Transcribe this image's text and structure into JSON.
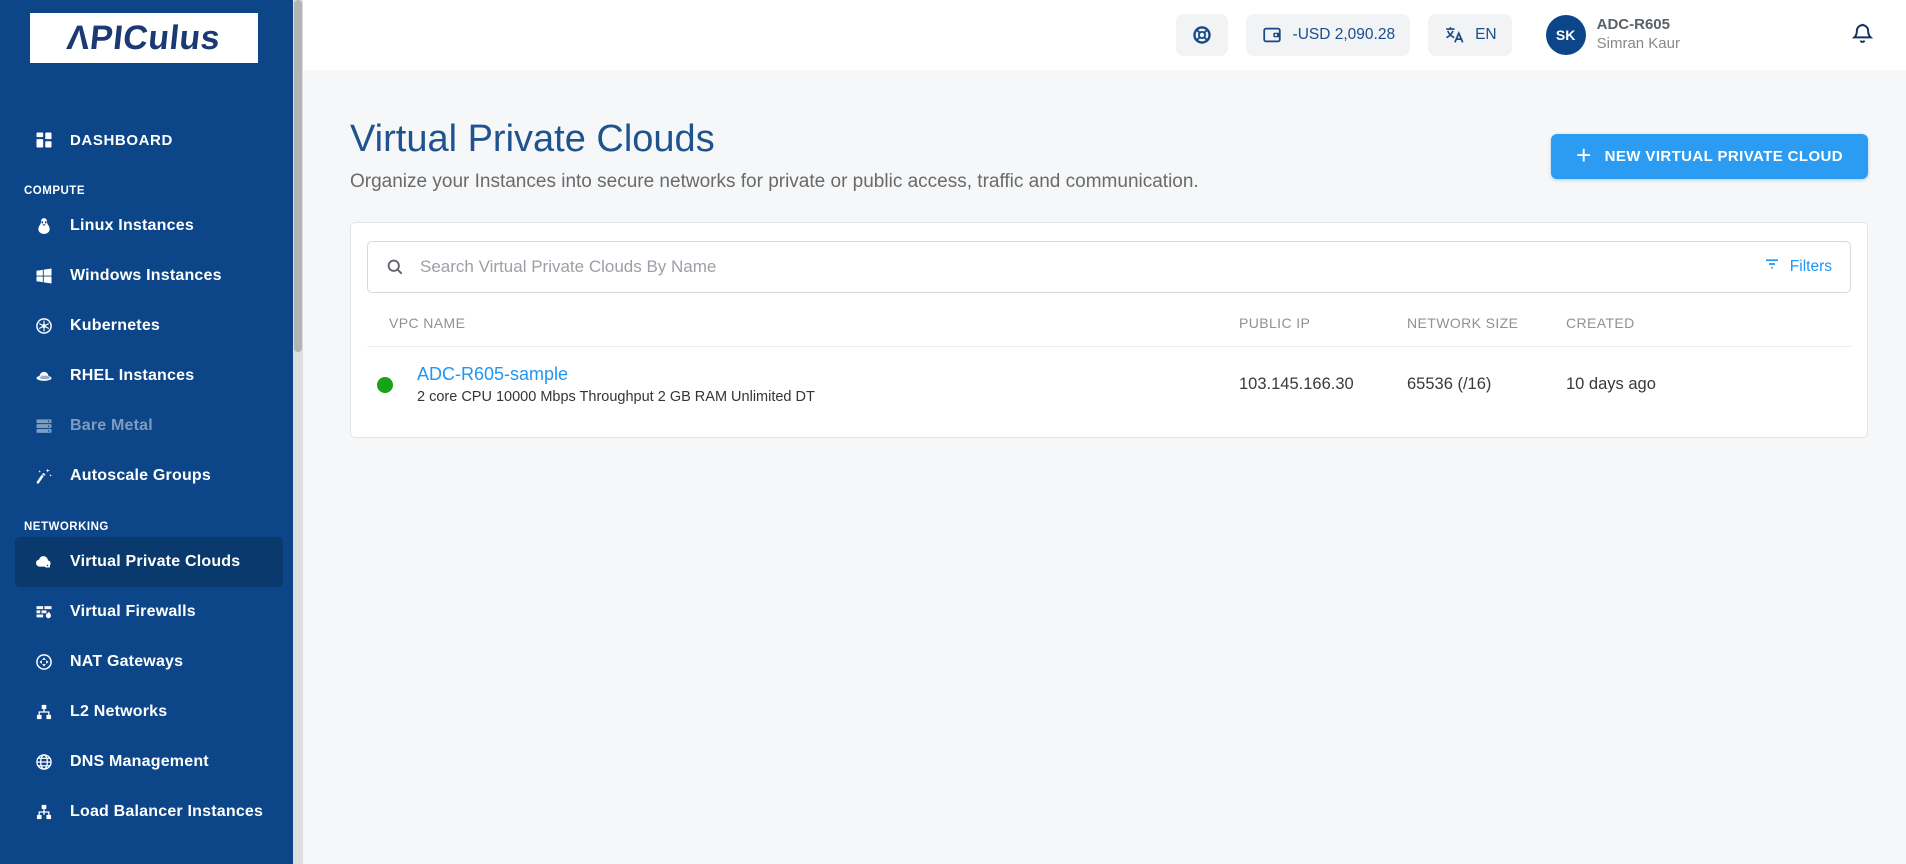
{
  "brand": {
    "logo_part1": "ΛPIC",
    "logo_part2": "ulus"
  },
  "sidebar": {
    "dashboard_label": "DASHBOARD",
    "compute_heading": "COMPUTE",
    "networking_heading": "NETWORKING",
    "compute_items": [
      {
        "label": "Linux Instances",
        "icon": "linux-icon"
      },
      {
        "label": "Windows Instances",
        "icon": "windows-icon"
      },
      {
        "label": "Kubernetes",
        "icon": "kubernetes-icon"
      },
      {
        "label": "RHEL Instances",
        "icon": "redhat-icon"
      },
      {
        "label": "Bare Metal",
        "icon": "server-icon",
        "state": "disabled"
      },
      {
        "label": "Autoscale Groups",
        "icon": "magic-wand-icon"
      }
    ],
    "networking_items": [
      {
        "label": "Virtual Private Clouds",
        "icon": "cloud-lock-icon",
        "state": "active"
      },
      {
        "label": "Virtual Firewalls",
        "icon": "firewall-icon"
      },
      {
        "label": "NAT Gateways",
        "icon": "nat-gateway-icon"
      },
      {
        "label": "L2 Networks",
        "icon": "l2-network-icon"
      },
      {
        "label": "DNS Management",
        "icon": "globe-icon"
      },
      {
        "label": "Load Balancer Instances",
        "icon": "load-balancer-icon"
      }
    ]
  },
  "header": {
    "balance": "-USD 2,090.28",
    "language": "EN",
    "account_code": "ADC-R605",
    "user_name": "Simran Kaur",
    "avatar_initials": "SK"
  },
  "page": {
    "title": "Virtual Private Clouds",
    "subtitle": "Organize your Instances into secure networks for private or public access, traffic and communication.",
    "new_button_label": "NEW VIRTUAL PRIVATE CLOUD",
    "new_button_plus": "+",
    "search_placeholder": "Search Virtual Private Clouds By Name",
    "filters_label": "Filters"
  },
  "table": {
    "columns": [
      "VPC NAME",
      "PUBLIC IP",
      "NETWORK SIZE",
      "CREATED"
    ],
    "rows": [
      {
        "name": "ADC-R605-sample",
        "description": "2 core CPU 10000 Mbps Throughput 2 GB RAM Unlimited DT",
        "status": "running",
        "public_ip": "103.145.166.30",
        "network_size": "65536 (/16)",
        "created": "10 days ago"
      }
    ]
  },
  "colors": {
    "sidebar_bg": "#0c4689",
    "sidebar_active_bg": "#0a3a6d",
    "accent_button": "#2b9cf2",
    "link_blue": "#2196f3",
    "title_blue": "#1e538f",
    "status_green": "#17a317"
  }
}
